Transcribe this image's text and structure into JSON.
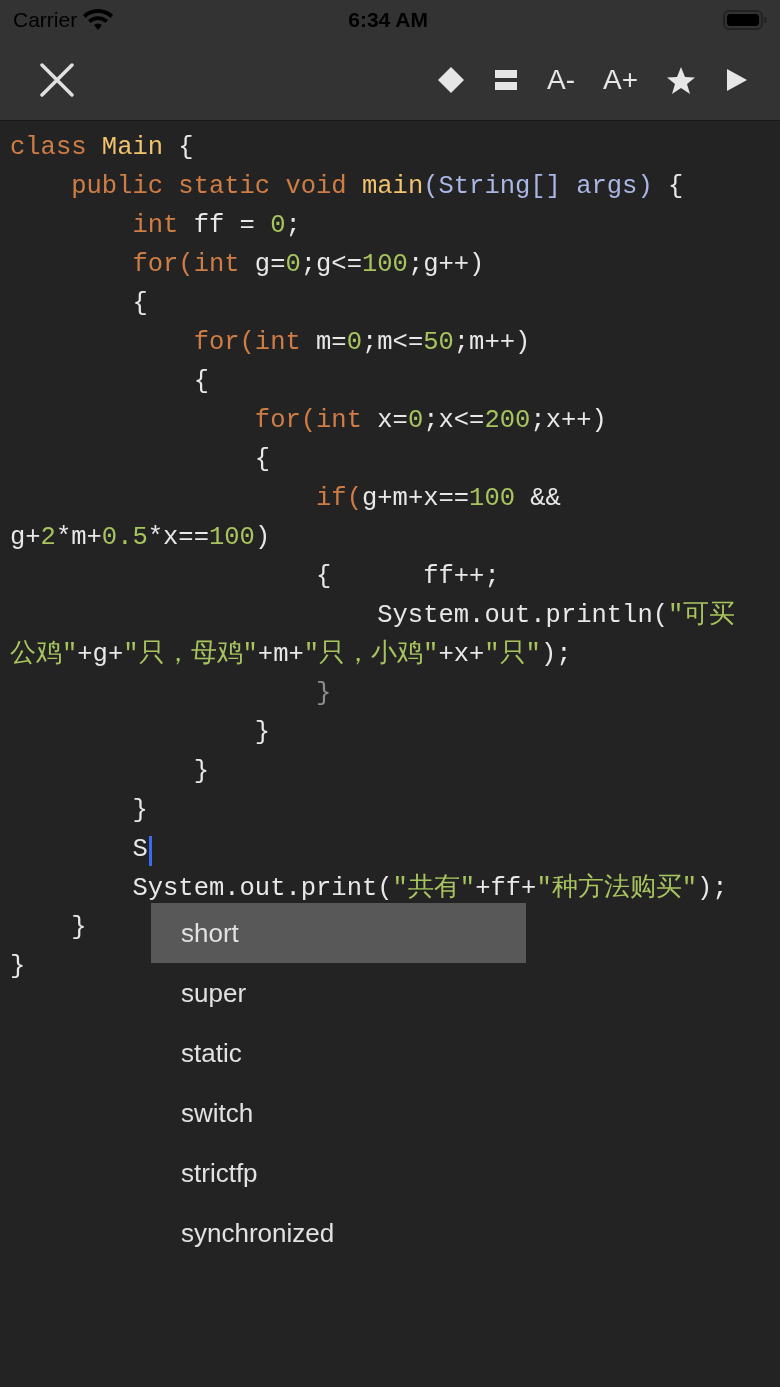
{
  "status_bar": {
    "carrier": "Carrier",
    "time": "6:34 AM"
  },
  "toolbar": [
    {
      "kind": "diamond"
    },
    {
      "kind": "lines"
    },
    {
      "kind": "text",
      "label": "A-"
    },
    {
      "kind": "text",
      "label": "A+"
    },
    {
      "kind": "star"
    },
    {
      "kind": "play"
    }
  ],
  "code_lines": [
    {
      "cursor": false,
      "tokens": [
        {
          "text": "class ",
          "kind": "keyword"
        },
        {
          "text": "Main",
          "kind": "name"
        },
        {
          "text": " {",
          "kind": "plain"
        }
      ]
    },
    {
      "cursor": false,
      "tokens": [
        {
          "text": "    public static void ",
          "kind": "keyword"
        },
        {
          "text": "main",
          "kind": "name"
        },
        {
          "text": "(String[] args)",
          "kind": "type"
        },
        {
          "text": " {",
          "kind": "plain"
        }
      ]
    },
    {
      "cursor": false,
      "tokens": [
        {
          "text": "        int ",
          "kind": "keyword"
        },
        {
          "text": "ff = ",
          "kind": "plain"
        },
        {
          "text": "0",
          "kind": "number"
        },
        {
          "text": ";",
          "kind": "plain"
        }
      ]
    },
    {
      "cursor": false,
      "tokens": [
        {
          "text": "        for(int ",
          "kind": "keyword"
        },
        {
          "text": "g=",
          "kind": "plain"
        },
        {
          "text": "0",
          "kind": "number"
        },
        {
          "text": ";g<=",
          "kind": "plain"
        },
        {
          "text": "100",
          "kind": "number"
        },
        {
          "text": ";g++)",
          "kind": "plain"
        }
      ]
    },
    {
      "cursor": false,
      "tokens": [
        {
          "text": "        {",
          "kind": "plain"
        }
      ]
    },
    {
      "cursor": false,
      "tokens": [
        {
          "text": "            for(int ",
          "kind": "keyword"
        },
        {
          "text": "m=",
          "kind": "plain"
        },
        {
          "text": "0",
          "kind": "number"
        },
        {
          "text": ";m<=",
          "kind": "plain"
        },
        {
          "text": "50",
          "kind": "number"
        },
        {
          "text": ";m++)",
          "kind": "plain"
        }
      ]
    },
    {
      "cursor": false,
      "tokens": [
        {
          "text": "            {",
          "kind": "plain"
        }
      ]
    },
    {
      "cursor": false,
      "tokens": [
        {
          "text": "                for(int ",
          "kind": "keyword"
        },
        {
          "text": "x=",
          "kind": "plain"
        },
        {
          "text": "0",
          "kind": "number"
        },
        {
          "text": ";x<=",
          "kind": "plain"
        },
        {
          "text": "200",
          "kind": "number"
        },
        {
          "text": ";x++)",
          "kind": "plain"
        }
      ]
    },
    {
      "cursor": false,
      "tokens": [
        {
          "text": "                {",
          "kind": "plain"
        }
      ]
    },
    {
      "cursor": false,
      "tokens": [
        {
          "text": "                    if(",
          "kind": "keyword"
        },
        {
          "text": "g+m+x==",
          "kind": "plain"
        },
        {
          "text": "100",
          "kind": "number"
        },
        {
          "text": " &&",
          "kind": "plain"
        }
      ]
    },
    {
      "cursor": false,
      "tokens": [
        {
          "text": "g+",
          "kind": "plain"
        },
        {
          "text": "2",
          "kind": "number"
        },
        {
          "text": "*m+",
          "kind": "plain"
        },
        {
          "text": "0.5",
          "kind": "number"
        },
        {
          "text": "*x==",
          "kind": "plain"
        },
        {
          "text": "100",
          "kind": "number"
        },
        {
          "text": ")",
          "kind": "plain"
        }
      ]
    },
    {
      "cursor": false,
      "tokens": [
        {
          "text": "                    {      ff++;",
          "kind": "plain"
        }
      ]
    },
    {
      "cursor": false,
      "tokens": [
        {
          "text": "                        System.out.println(",
          "kind": "plain"
        },
        {
          "text": "\"可买",
          "kind": "string"
        }
      ]
    },
    {
      "cursor": false,
      "tokens": [
        {
          "text": "公鸡\"",
          "kind": "string"
        },
        {
          "text": "+g+",
          "kind": "plain"
        },
        {
          "text": "\"只，母鸡\"",
          "kind": "string"
        },
        {
          "text": "+m+",
          "kind": "plain"
        },
        {
          "text": "\"只，小鸡\"",
          "kind": "string"
        },
        {
          "text": "+x+",
          "kind": "plain"
        },
        {
          "text": "\"只\"",
          "kind": "string"
        },
        {
          "text": ");",
          "kind": "plain"
        }
      ]
    },
    {
      "cursor": false,
      "tokens": [
        {
          "text": "                    }",
          "kind": "muted"
        }
      ]
    },
    {
      "cursor": false,
      "tokens": [
        {
          "text": "                }",
          "kind": "plain"
        }
      ]
    },
    {
      "cursor": false,
      "tokens": [
        {
          "text": "            }",
          "kind": "plain"
        }
      ]
    },
    {
      "cursor": false,
      "tokens": [
        {
          "text": "        }",
          "kind": "plain"
        }
      ]
    },
    {
      "cursor": true,
      "tokens": [
        {
          "text": "        S",
          "kind": "plain"
        }
      ]
    },
    {
      "cursor": false,
      "tokens": [
        {
          "text": "        System.out.print(",
          "kind": "plain"
        },
        {
          "text": "\"共有\"",
          "kind": "string"
        },
        {
          "text": "+ff+",
          "kind": "plain"
        },
        {
          "text": "\"种方法购买\"",
          "kind": "string"
        },
        {
          "text": ");",
          "kind": "plain"
        }
      ]
    },
    {
      "cursor": false,
      "tokens": [
        {
          "text": "    }",
          "kind": "plain"
        }
      ]
    },
    {
      "cursor": false,
      "tokens": [
        {
          "text": "}",
          "kind": "plain"
        }
      ]
    }
  ],
  "suggestions": [
    {
      "label": "short",
      "selected": true
    },
    {
      "label": "super",
      "selected": false
    },
    {
      "label": "static",
      "selected": false
    },
    {
      "label": "switch",
      "selected": false
    },
    {
      "label": "strictfp",
      "selected": false
    },
    {
      "label": "synchronized",
      "selected": false
    }
  ]
}
